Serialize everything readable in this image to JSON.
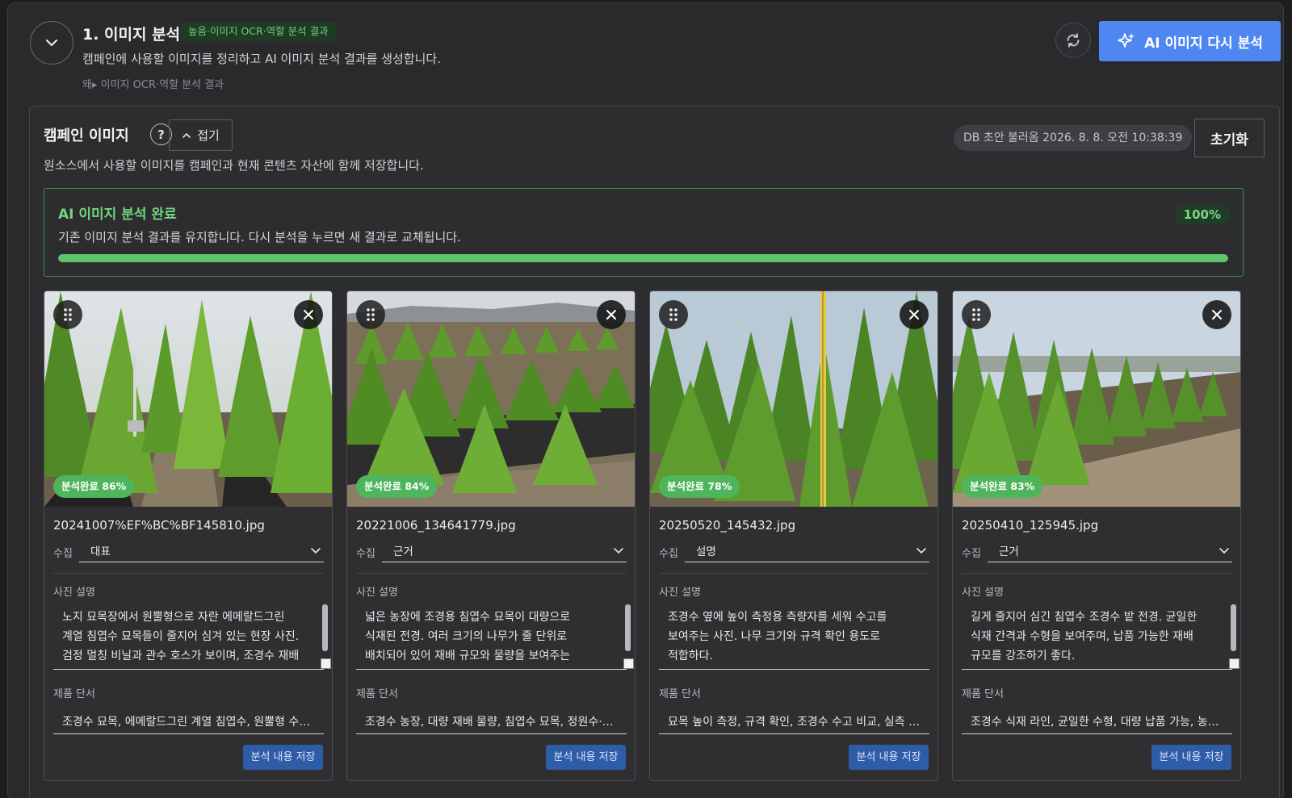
{
  "header": {
    "step_title": "1. 이미지 분석",
    "step_badge": "높음·이미지 OCR·역할 분석 결과",
    "description": "캠페인에 사용할 이미지를 정리하고 AI 이미지 분석 결과를 생성합니다.",
    "why": "왜▸ 이미지 OCR·역할 분석 결과",
    "reanalyze_label": "AI 이미지 다시 분석",
    "icons": {
      "collapse": "chevron-down-icon",
      "refresh": "refresh-icon",
      "sparkle": "sparkle-icon"
    },
    "accent_color": "#4e86f2"
  },
  "campaign": {
    "title": "캠페인 이미지",
    "help": "?",
    "fold_label": "접기",
    "description": "원소스에서 사용할 이미지를 캠페인과 현재 콘텐츠 자산에 함께 저장합니다.",
    "db_status": "DB 초안 불러옴 2026. 8. 8. 오전 10:38:39",
    "reset_label": "초기화"
  },
  "analysis": {
    "title": "AI 이미지 분석 완료",
    "description": "기존 이미지 분석 결과를 유지합니다. 다시 분석을 누르면 새 결과로 교체됩니다.",
    "percent_label": "100%",
    "progress": 1.0,
    "status_color": "#5fc46c"
  },
  "labels": {
    "role": "수집",
    "photo_desc": "사진 설명",
    "product_clue": "제품 단서",
    "save": "분석 내용 저장"
  },
  "cards": [
    {
      "badge": "분석완료 86%",
      "filename": "20241007%EF%BC%BF145810.jpg",
      "role": "대표",
      "description": "노지 묘목장에서 원뿔형으로 자란 에메랄드그린 계열 침엽수 묘목들이 줄지어 심겨 있는 현장 사진. 검정 멀칭 비닐과 관수 호스가 보이며, 조경수 재배·판",
      "product": "조경수 묘목, 에메랄드그린 계열 침엽수, 원뿔형 수형, 노지 재배",
      "has_scrollbar": true
    },
    {
      "badge": "분석완료 84%",
      "filename": "20221006_134641779.jpg",
      "role": "근거",
      "description": "넓은 농장에 조경용 침엽수 묘목이 대량으로 식재된 전경. 여러 크기의 나무가 줄 단위로 배치되어 있어 재배 규모와 물량을 보여주는 이미지다.",
      "product": "조경수 농장, 대량 재배 물량, 침엽수 묘목, 정원수·울타리",
      "has_scrollbar": true
    },
    {
      "badge": "분석완료 78%",
      "filename": "20250520_145432.jpg",
      "role": "설명",
      "description": "조경수 옆에 높이 측정용 측량자를 세워 수고를 보여주는 사진. 나무 크기와 규격 확인 용도로 적합하다.",
      "product": "묘목 높이 측정, 규격 확인, 조경수 수고 비교, 실측 사진",
      "has_scrollbar": false
    },
    {
      "badge": "분석완료 83%",
      "filename": "20250410_125945.jpg",
      "role": "근거",
      "description": "길게 줄지어 심긴 침엽수 조경수 밭 전경. 균일한 식재 간격과 수형을 보여주며, 납품 가능한 재배 규모를 강조하기 좋다.",
      "product": "조경수 식재 라인, 균일한 수형, 대량 납품 가능, 농장 전경",
      "has_scrollbar": true
    }
  ]
}
